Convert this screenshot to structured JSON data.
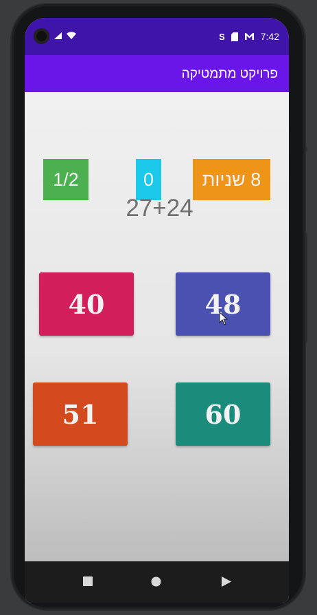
{
  "status_bar": {
    "time": "7:42",
    "badge_icon_text": "S",
    "colors": {
      "background": "#3f14a8"
    }
  },
  "app_bar": {
    "title": "פרויקט מתמטיקה",
    "color": "#6b16e8"
  },
  "game": {
    "timer": "8 שניות",
    "score": "0",
    "progress": "1/2",
    "question": "27+24",
    "answers": [
      {
        "label": "40",
        "color": "#d21f5c"
      },
      {
        "label": "48",
        "color": "#4a51b0"
      },
      {
        "label": "51",
        "color": "#d24a1e"
      },
      {
        "label": "60",
        "color": "#1b8b7c"
      }
    ]
  },
  "nav_bar": {
    "icons": [
      "recents-square-icon",
      "home-circle-icon",
      "back-triangle-icon"
    ]
  }
}
